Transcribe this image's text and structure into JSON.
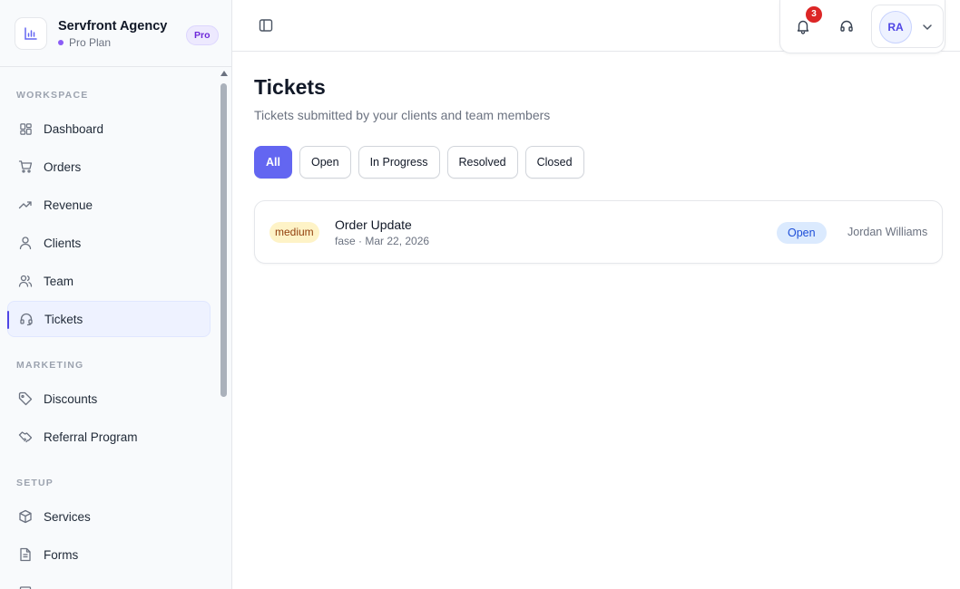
{
  "brand": {
    "name": "Servfront Agency",
    "plan": "Pro Plan",
    "badge": "Pro"
  },
  "sidebar": {
    "sections": [
      {
        "label": "WORKSPACE"
      },
      {
        "label": "MARKETING"
      },
      {
        "label": "SETUP"
      }
    ],
    "items": [
      {
        "label": "Dashboard",
        "icon": "grid-icon"
      },
      {
        "label": "Orders",
        "icon": "cart-icon"
      },
      {
        "label": "Revenue",
        "icon": "trending-up-icon"
      },
      {
        "label": "Clients",
        "icon": "user-icon"
      },
      {
        "label": "Team",
        "icon": "users-icon"
      },
      {
        "label": "Tickets",
        "icon": "headset-icon",
        "active": true
      },
      {
        "label": "Discounts",
        "icon": "tag-icon"
      },
      {
        "label": "Referral Program",
        "icon": "handshake-icon"
      },
      {
        "label": "Services",
        "icon": "box-icon"
      },
      {
        "label": "Forms",
        "icon": "file-icon"
      }
    ]
  },
  "topbar": {
    "notifications_count": "3",
    "user_initials": "RA"
  },
  "page": {
    "title": "Tickets",
    "subtitle": "Tickets submitted by your clients and team members"
  },
  "filters": [
    {
      "label": "All",
      "active": true
    },
    {
      "label": "Open"
    },
    {
      "label": "In Progress"
    },
    {
      "label": "Resolved"
    },
    {
      "label": "Closed"
    }
  ],
  "tickets": [
    {
      "priority": "medium",
      "title": "Order Update",
      "meta": "fase · Mar 22, 2026",
      "status": "Open",
      "assignee": "Jordan Williams"
    }
  ],
  "colors": {
    "accent": "#6366f1",
    "active_nav_bg": "#eef2ff",
    "badge_red": "#dc2626"
  }
}
